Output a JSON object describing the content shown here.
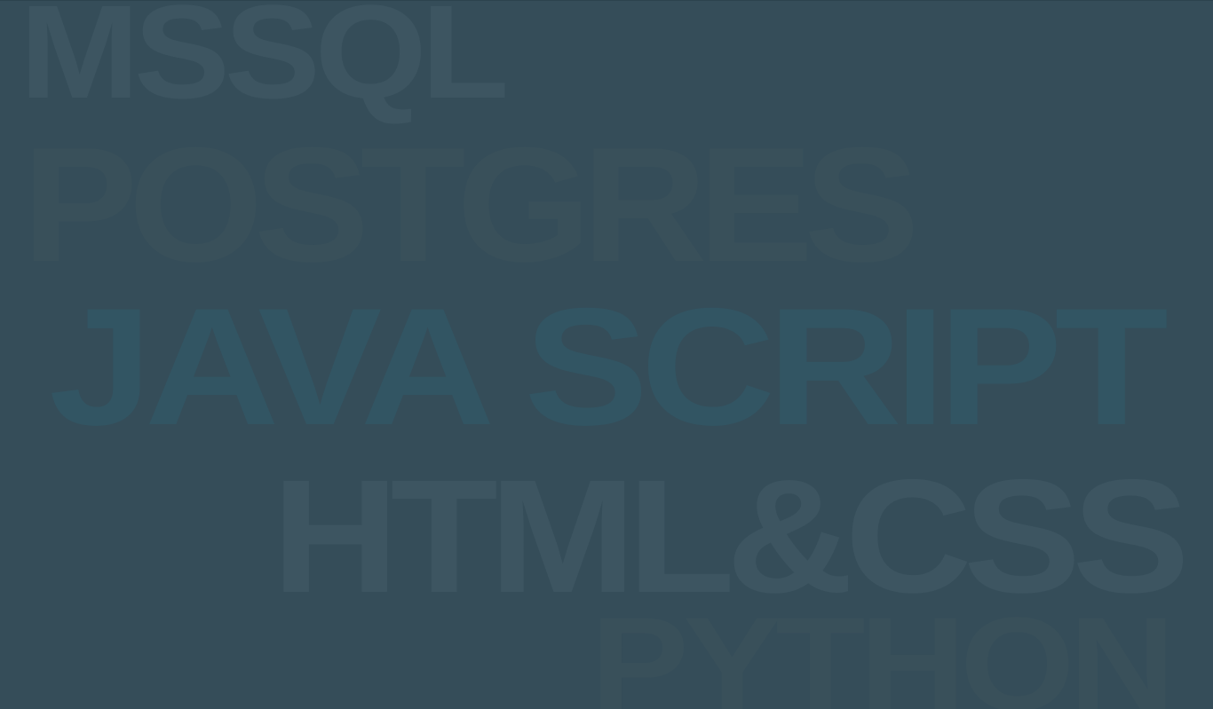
{
  "background": {
    "color": "#354d59",
    "words": [
      {
        "id": "mssql",
        "text": "MSSQL",
        "color": "#3d5561"
      },
      {
        "id": "postgres",
        "text": "POSTGRES",
        "color": "#39505a"
      },
      {
        "id": "javascript",
        "text": "JAVA SCRIPT",
        "color": "#325563"
      },
      {
        "id": "htmlcss",
        "text": "HTML&CSS",
        "color": "#3d5561"
      },
      {
        "id": "python",
        "text": "PYTHON",
        "color": "#39505a"
      }
    ]
  }
}
